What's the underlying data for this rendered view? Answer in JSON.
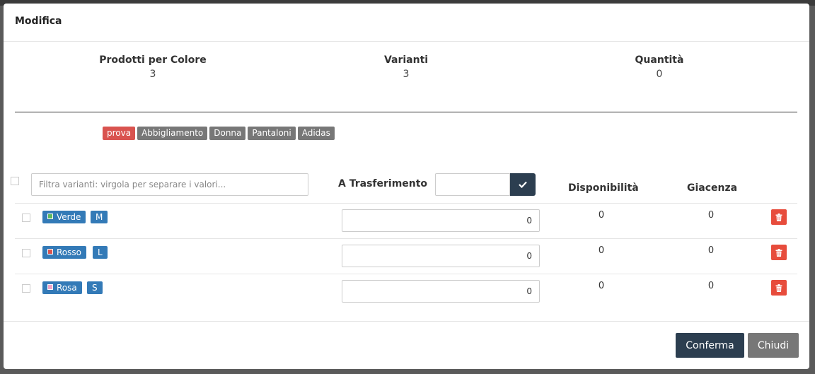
{
  "modal": {
    "title": "Modifica"
  },
  "stats": [
    {
      "label": "Prodotti per Colore",
      "value": "3"
    },
    {
      "label": "Varianti",
      "value": "3"
    },
    {
      "label": "Quantità",
      "value": "0"
    }
  ],
  "tags": [
    {
      "label": "prova",
      "color": "#d9534f"
    },
    {
      "label": "Abbigliamento",
      "color": "#777777"
    },
    {
      "label": "Donna",
      "color": "#777777"
    },
    {
      "label": "Pantaloni",
      "color": "#777777"
    },
    {
      "label": "Adidas",
      "color": "#777777"
    }
  ],
  "filter": {
    "placeholder": "Filtra varianti: virgola per separare i valori..."
  },
  "columns": {
    "transfer": "A Trasferimento",
    "availability": "Disponibilità",
    "stock": "Giacenza"
  },
  "transfer_input": {
    "value": ""
  },
  "rows": [
    {
      "color": "Verde",
      "swatch": "#5cb85c",
      "size": "M",
      "qty": "0",
      "availability": "0",
      "stock": "0"
    },
    {
      "color": "Rosso",
      "swatch": "#d9534f",
      "size": "L",
      "qty": "0",
      "availability": "0",
      "stock": "0"
    },
    {
      "color": "Rosa",
      "swatch": "#f4a6c8",
      "size": "S",
      "qty": "0",
      "availability": "0",
      "stock": "0"
    }
  ],
  "footer": {
    "confirm": "Conferma",
    "close": "Chiudi"
  }
}
